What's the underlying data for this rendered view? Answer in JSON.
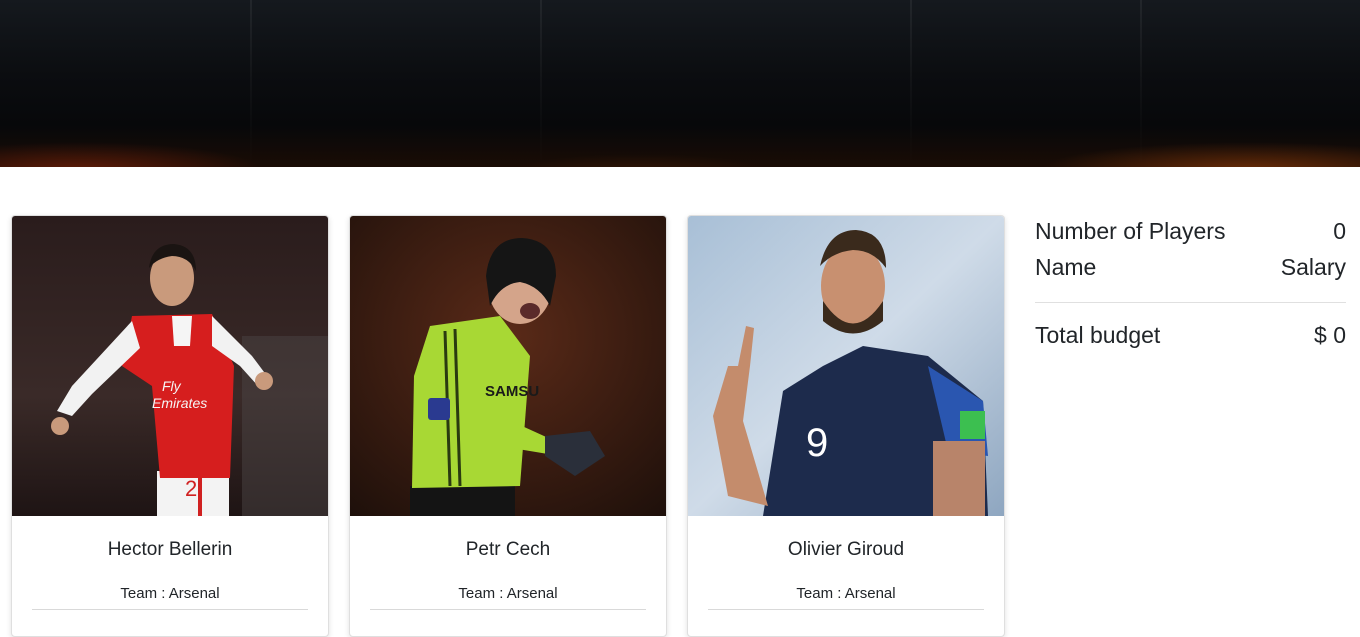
{
  "players": [
    {
      "name": "Hector Bellerin",
      "team_label": "Team : Arsenal"
    },
    {
      "name": "Petr Cech",
      "team_label": "Team : Arsenal"
    },
    {
      "name": "Olivier Giroud",
      "team_label": "Team : Arsenal"
    }
  ],
  "summary": {
    "players_label": "Number of Players",
    "players_count": "0",
    "name_header": "Name",
    "salary_header": "Salary",
    "total_label": "Total budget",
    "total_value": "$ 0"
  }
}
